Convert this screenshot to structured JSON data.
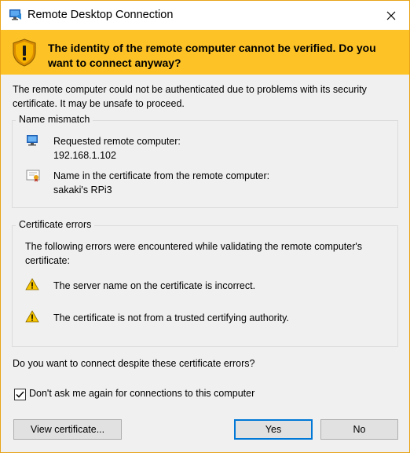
{
  "window": {
    "title": "Remote Desktop Connection"
  },
  "banner": {
    "message": "The identity of the remote computer cannot be verified. Do you want to connect anyway?"
  },
  "intro": "The remote computer could not be authenticated due to problems with its security certificate. It may be unsafe to proceed.",
  "name_mismatch": {
    "legend": "Name mismatch",
    "requested_label": "Requested remote computer:",
    "requested_value": "192.168.1.102",
    "cert_label": "Name in the certificate from the remote computer:",
    "cert_value": "sakaki's RPi3"
  },
  "certificate_errors": {
    "legend": "Certificate errors",
    "intro": "The following errors were encountered while validating the remote computer's certificate:",
    "errors": [
      "The server name on the certificate is incorrect.",
      "The certificate is not from a trusted certifying authority."
    ]
  },
  "question": "Do you want to connect despite these certificate errors?",
  "dont_ask": {
    "label": "Don't ask me again for connections to this computer",
    "checked": true
  },
  "buttons": {
    "view_certificate": "View certificate...",
    "yes": "Yes",
    "no": "No"
  },
  "colors": {
    "banner": "#fcc226",
    "accent": "#0078d7",
    "border": "#e8a317"
  },
  "icons": [
    "remote-desktop-icon",
    "close-icon",
    "security-shield-warning-icon",
    "computer-icon",
    "certificate-icon",
    "warning-icon"
  ]
}
